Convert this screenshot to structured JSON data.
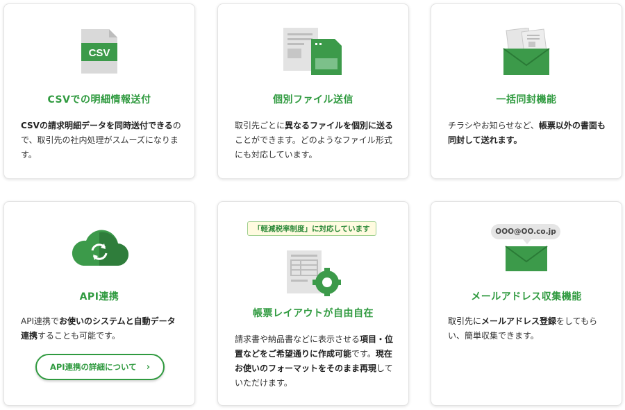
{
  "cards": [
    {
      "title": "CSVでの明細情報送付",
      "icon_label": "CSV",
      "icon": "csv-file-icon",
      "desc": [
        {
          "text": "CSVの請求明細データを同時送付できる",
          "bold": true
        },
        {
          "text": "ので、取引先の社内処理がスムーズにな",
          "bold": false
        },
        {
          "text": "ります。",
          "bold": false
        }
      ]
    },
    {
      "title": "個別ファイル送信",
      "icon": "individual-files-icon",
      "desc": [
        {
          "text": "取引先ごとに",
          "bold": false
        },
        {
          "text": "異なるファイルを個別に送る",
          "bold": true
        },
        {
          "text": "ことができます。どのようなファイル",
          "bold": false
        },
        {
          "text": "形式にも対応しています。",
          "bold": false
        }
      ]
    },
    {
      "title": "一括同封機能",
      "icon": "envelope-with-documents-icon",
      "desc": [
        {
          "text": "チラシやお知らせなど、",
          "bold": false
        },
        {
          "text": "帳票以外の書面も同封して送れます。",
          "bold": true
        }
      ]
    },
    {
      "title": "API連携",
      "icon": "cloud-sync-icon",
      "desc": [
        {
          "text": "API連携で",
          "bold": false
        },
        {
          "text": "お使いのシステムと自動データ連携",
          "bold": true
        },
        {
          "text": "することも可能です。",
          "bold": false
        }
      ],
      "button_label": "API連携の詳細について"
    },
    {
      "title": "帳票レイアウトが自由自在",
      "badge": "「軽減税率制度」に対応しています",
      "icon": "layout-settings-gear-icon",
      "desc": [
        {
          "text": "請求書や納品書などに表示させる",
          "bold": false
        },
        {
          "text": "項目・位置などをご希望通りに作成可能",
          "bold": true
        },
        {
          "text": "です。",
          "bold": false
        },
        {
          "text": "現在お使いのフォーマットをそのまま再現",
          "bold": true
        },
        {
          "text": "していただけます。",
          "bold": false
        }
      ]
    },
    {
      "title": "メールアドレス収集機能",
      "email_bubble": "OOO@OO.co.jp",
      "icon": "email-envelope-icon",
      "desc": [
        {
          "text": "取引先に",
          "bold": false
        },
        {
          "text": "メールアドレス登録",
          "bold": true
        },
        {
          "text": "をしてもらい、簡単収集できます。",
          "bold": false
        }
      ]
    }
  ],
  "colors": {
    "accent": "#2f9a3f",
    "icon_green": "#3c9a4a",
    "icon_gray": "#d9d9d9",
    "badge_bg": "#fffbe0"
  }
}
